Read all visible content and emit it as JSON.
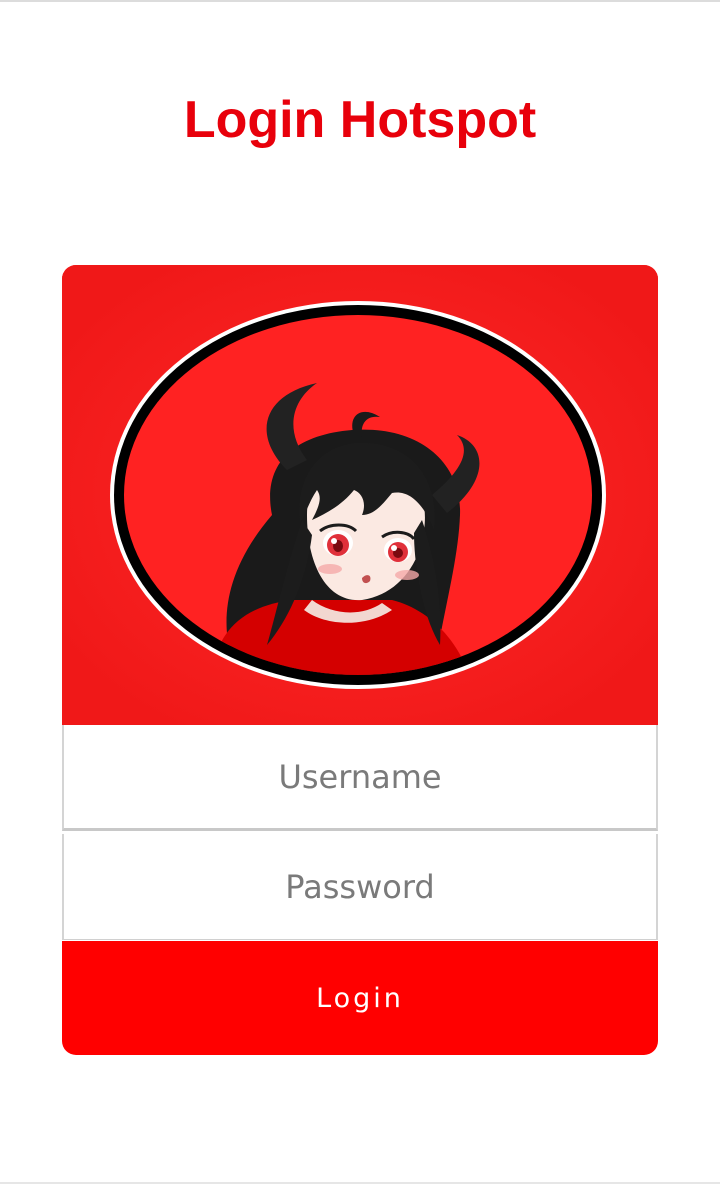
{
  "page": {
    "title": "Login Hotspot"
  },
  "form": {
    "username_placeholder": "Username",
    "password_placeholder": "Password",
    "login_label": "Login"
  },
  "colors": {
    "accent": "#ff0000",
    "title": "#e8000b",
    "banner": "#ff2222"
  },
  "banner": {
    "image": "anime-devil-girl-logo"
  }
}
